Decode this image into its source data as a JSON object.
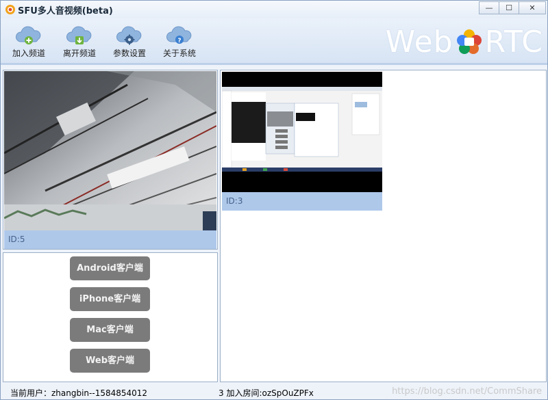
{
  "window": {
    "title": "SFU多人音视频(beta)",
    "controls": {
      "minimize": "—",
      "maximize": "☐",
      "close": "✕"
    }
  },
  "toolbar": {
    "items": [
      {
        "label": "加入频道",
        "icon": "cloud-plus-icon",
        "color": "#6fb43f"
      },
      {
        "label": "离开频道",
        "icon": "cloud-download-icon",
        "color": "#6fb43f"
      },
      {
        "label": "参数设置",
        "icon": "cloud-gear-icon",
        "color": "#3b5f8a"
      },
      {
        "label": "关于系统",
        "icon": "cloud-help-icon",
        "color": "#3a7fd0"
      }
    ],
    "logo": {
      "left": "Web",
      "right": "RTC"
    }
  },
  "videos": {
    "main": {
      "id_label": "ID:5"
    },
    "remote": {
      "id_label": "ID:3"
    }
  },
  "clients": {
    "buttons": [
      "Android客户端",
      "iPhone客户端",
      "Mac客户端",
      "Web客户端"
    ]
  },
  "status": {
    "user": "当前用户：zhangbin--1584854012",
    "room": "3 加入房间:ozSpOuZPFx",
    "watermark": "https://blog.csdn.net/CommShare"
  },
  "colors": {
    "accent": "#aec8ea",
    "id_text": "#44618a",
    "client_button": "#7b7b7b"
  }
}
